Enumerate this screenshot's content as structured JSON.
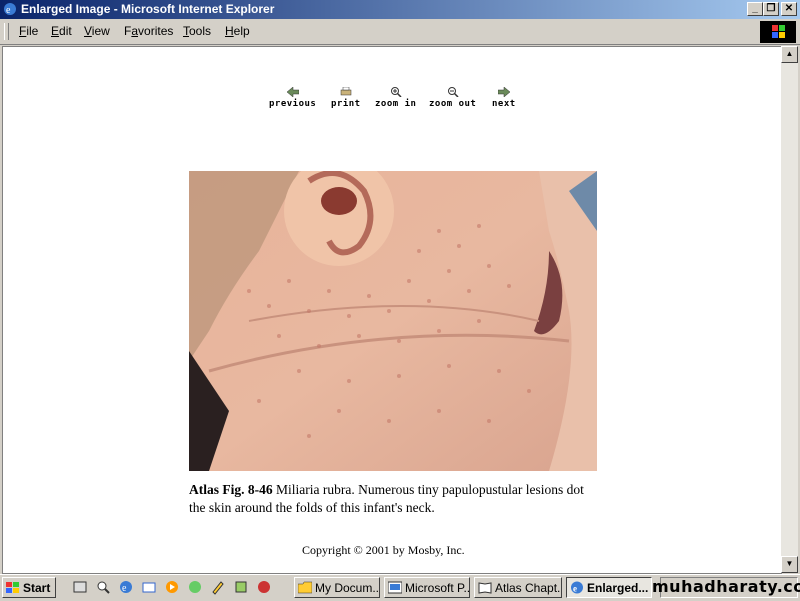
{
  "window": {
    "title": "Enlarged Image - Microsoft Internet Explorer"
  },
  "menu": [
    {
      "label": "File",
      "u": "F",
      "rest": "ile"
    },
    {
      "label": "Edit",
      "u": "E",
      "rest": "dit"
    },
    {
      "label": "View",
      "u": "V",
      "rest": "iew"
    },
    {
      "label": "Favorites",
      "u": "F",
      "rest": "a"
    },
    {
      "label": "Tools",
      "u": "T",
      "rest": "ools"
    },
    {
      "label": "Help",
      "u": "H",
      "rest": "elp"
    }
  ],
  "nav": {
    "previous": "previous",
    "print": "print",
    "zoom_in": "zoom in",
    "zoom_out": "zoom out",
    "next": "next"
  },
  "figure": {
    "label": "Atlas Fig. 8-46",
    "caption": "Miliaria rubra. Numerous tiny papulopustular lesions dot the skin around the folds of this infant's neck."
  },
  "copyright": "Copyright © 2001 by Mosby, Inc.",
  "taskbar": {
    "start": "Start",
    "tasks": [
      {
        "label": "My Docum..."
      },
      {
        "label": "Microsoft P..."
      },
      {
        "label": "Atlas Chapt..."
      },
      {
        "label": "Enlarged..."
      }
    ]
  },
  "watermark": "muhadharaty.com"
}
